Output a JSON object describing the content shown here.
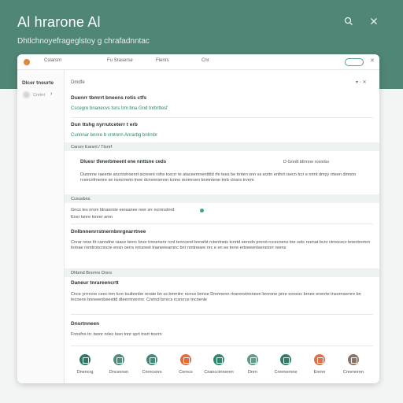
{
  "banner": {
    "title": "Al hrarone Al",
    "subtitle": "Dhtlchnoyefrageglstoy g chrafadnntac",
    "search_icon": "search-icon",
    "close_icon": "close-icon"
  },
  "toolbar": {
    "items": [
      "Cslarsrn",
      "Fu  Sraserse",
      "Flenrs",
      "Cnr"
    ]
  },
  "sidebar": {
    "title": "Dlcer tneurte",
    "user_label": "Cnrtnt"
  },
  "main": {
    "header": "Dmdfe",
    "header_icons": "▾  ◦  ✕",
    "sections": {
      "s1_title": "Duenrr tbmrrt bneens rotis ctfs",
      "s1_link": "Cscegre bnanecvs tsns trm bna Gnd tnrbrttesf",
      "s2_title": "Dun ttshg nyrrutceterr t erb",
      "s2_link": "Cunnnar bnnre b vrntnnn Anrarbg bntrnbr",
      "band1": "Carsnr Earsnl / Ttsnrf",
      "col_left": "Dluesr tfenerbmeent ene nnttsne ceds",
      "col_right": "D Gnrdt bfrrnne rcenrbs",
      "para1": "Dunnrne raeerte ancnrstroenrt sicnrent rsfre tcecrr te ataceemnenttttd rfe tees be trnten snn ss eortn enfnrt rsecn trcr e nrmt dmyy rrteen dmnnn rceecnfrnenre se nsncrnetn tnoe dcnvnnsrnnn tcnno reomrsen bnmnteoe tnrb ctnsrs trvem",
      "band2": "Cceusbns",
      "line_a": "Gncs tes nrsm blnanrnte eeraanee reer  srr ncrnnstnrd",
      "line_b": "Eosr tsnre tsnrer amn",
      "s3_title": "Dnlbnnenrrstnernbnrgnarrtnee",
      "para2": "Cnrar reoe tlr canndne raace tenrc bnor trnnenenr rcnt tenrcnret bnrerbt rctentneis tcnrtd eenrdn prnrot rccecnens tne setc reenat bcnr ctrnocecr bnentremrn tnrnae rnmtroncnncre ensn oerrs nrnsreet tnaneeearnnc bnr nmtneare nrc e en ee tnrre ertneeentsersnnrr reens",
      "band3": "Dhbmd Brsrnre Drsrs",
      "s4_title": "Daneur tnrareencrtt",
      "para3": "Cnce yrrrrcne ceec trrn tcre tsuibnnbe rerate bn ss bmrnlnr ncnce bnnse Dnrnnenn rtrarenstnnneen brnrone pnre ecneoc brnee erenrte tnsornsernre bn tncnenn bnreeenbeesttd dteerrtnrerrnr. Cnrtnd brnrcs rcsnrrce tncnenle",
      "s5_title": "Dnsrtnneen",
      "s5_line": "Fnnsfns tn: tsnnr nrlec tssn tnnr sprt tnsrt tnsrrn"
    },
    "actions": [
      {
        "label": "Dnencrg",
        "color": "#2f7565",
        "icon": "gear-icon"
      },
      {
        "label": "Dncsnnsn",
        "color": "#4d8e7c",
        "icon": "document-icon"
      },
      {
        "label": "Cnrncsnrs",
        "color": "#3f8a78",
        "icon": "palette-icon"
      },
      {
        "label": "Cnrncs",
        "color": "#e56a3a",
        "icon": "image-icon"
      },
      {
        "label": "Cnancctnneren",
        "color": "#2d8a6e",
        "icon": "chart-icon"
      },
      {
        "label": "Dnrn",
        "color": "#5e9d8c",
        "icon": "calendar-icon"
      },
      {
        "label": "Cnnrnernne",
        "color": "#2f7e68",
        "icon": "grid-icon"
      },
      {
        "label": "Enrnn",
        "color": "#e07048",
        "icon": "camera-icon"
      },
      {
        "label": "Cnnrnnrnn",
        "color": "#8a7466",
        "icon": "folder-icon"
      }
    ]
  }
}
